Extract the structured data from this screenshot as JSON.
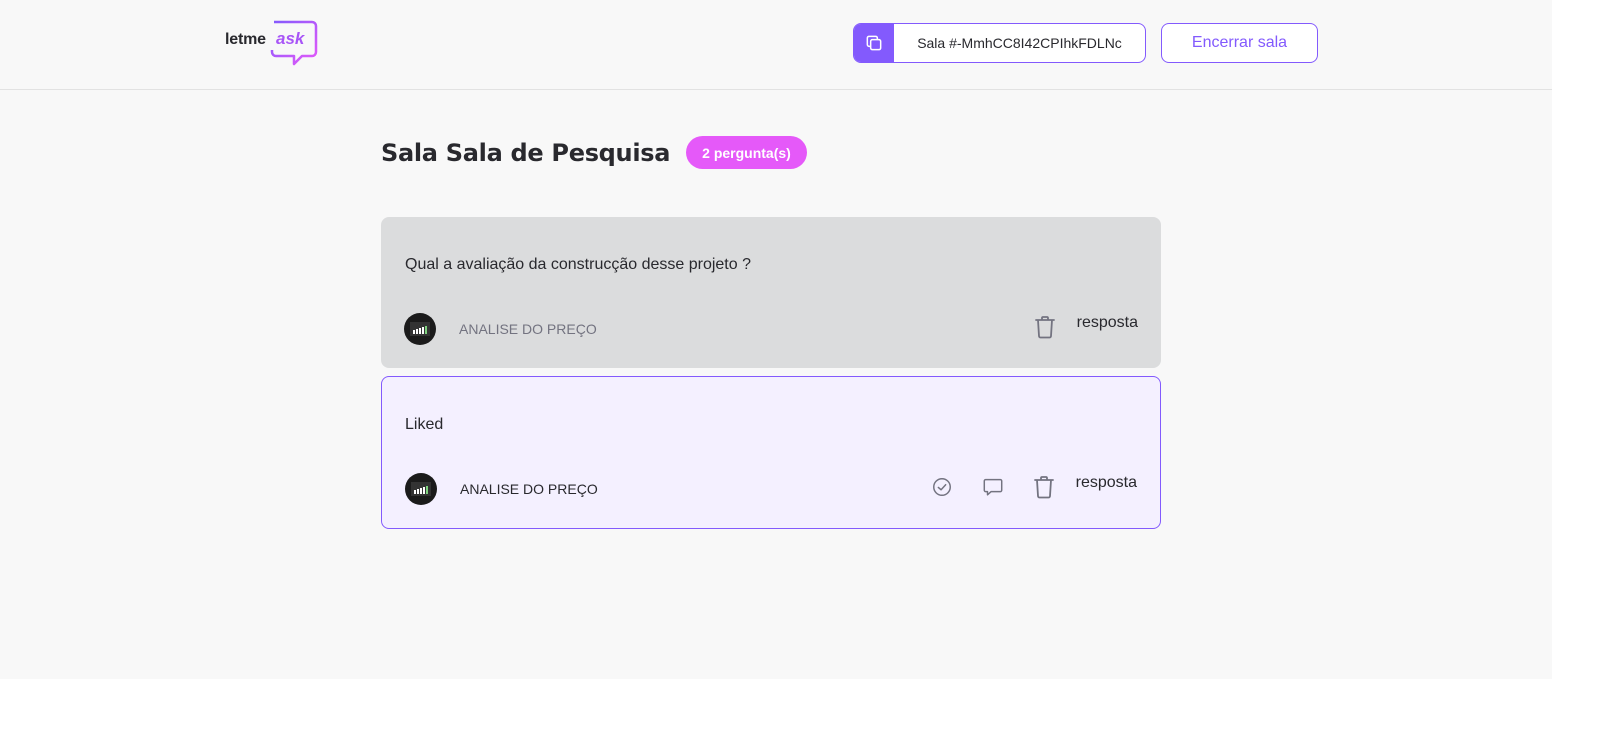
{
  "header": {
    "logo_text_letme": "letme",
    "logo_text_ask": "ask",
    "room_code": "Sala #-MmhCC8I42CPIhkFDLNc",
    "end_room_label": "Encerrar sala",
    "brand_color": "#835afd"
  },
  "room": {
    "title": "Sala Sala de Pesquisa",
    "question_count_badge": "2 pergunta(s)",
    "badge_color": "#e559f9"
  },
  "questions": [
    {
      "content": "Qual a avaliação da construcção desse projeto ?",
      "author": "ANALISE DO PREÇO",
      "state": "answered",
      "reply_label": "resposta"
    },
    {
      "content": "Liked",
      "author": "ANALISE DO PREÇO",
      "state": "highlighted",
      "reply_label": "resposta"
    }
  ],
  "icons": {
    "copy": "copy-icon",
    "check": "check-circle-icon",
    "answer": "chat-bubble-icon",
    "delete": "trash-icon"
  }
}
